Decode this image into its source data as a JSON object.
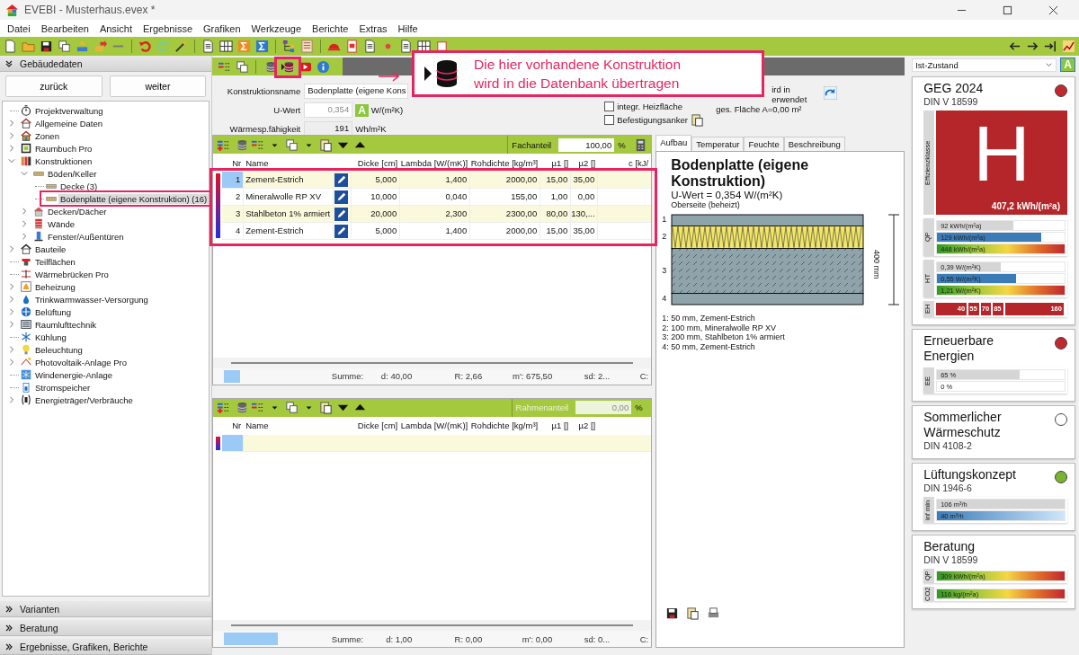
{
  "window": {
    "title": "EVEBI - Musterhaus.evex *"
  },
  "menu": [
    "Datei",
    "Bearbeiten",
    "Ansicht",
    "Ergebnisse",
    "Grafiken",
    "Werkzeuge",
    "Berichte",
    "Extras",
    "Hilfe"
  ],
  "left_panel": {
    "header": "Gebäudedaten",
    "buttons": [
      "zurück",
      "weiter"
    ],
    "tree": [
      {
        "label": "Projektverwaltung",
        "kind": "leaf",
        "selected": false
      },
      {
        "label": "Allgemeine Daten",
        "kind": "folder",
        "expanded": false,
        "selected": false
      },
      {
        "label": "Zonen",
        "kind": "folder",
        "expanded": false,
        "selected": false
      },
      {
        "label": "Raumbuch Pro",
        "kind": "folder",
        "expanded": false,
        "selected": false
      },
      {
        "label": "Konstruktionen",
        "kind": "folder",
        "expanded": true,
        "selected": false,
        "children": [
          {
            "label": "Böden/Keller",
            "kind": "folder",
            "expanded": true,
            "selected": false,
            "children": [
              {
                "label": "Decke (3)",
                "kind": "leaf",
                "selected": false
              },
              {
                "label": "Bodenplatte (eigene Konstruktion) (16)",
                "kind": "leaf",
                "selected": true
              }
            ]
          },
          {
            "label": "Decken/Dächer",
            "kind": "folder",
            "expanded": false,
            "selected": false
          },
          {
            "label": "Wände",
            "kind": "folder",
            "expanded": false,
            "selected": false
          },
          {
            "label": "Fenster/Außentüren",
            "kind": "folder",
            "expanded": false,
            "selected": false
          }
        ]
      },
      {
        "label": "Bauteile",
        "kind": "folder",
        "expanded": false,
        "selected": false
      },
      {
        "label": "Teilflächen",
        "kind": "leaf",
        "selected": false
      },
      {
        "label": "Wärmebrücken Pro",
        "kind": "leaf",
        "selected": false
      },
      {
        "label": "Beheizung",
        "kind": "folder",
        "expanded": false,
        "selected": false
      },
      {
        "label": "Trinkwarmwasser-Versorgung",
        "kind": "folder",
        "expanded": false,
        "selected": false
      },
      {
        "label": "Belüftung",
        "kind": "folder",
        "expanded": false,
        "selected": false
      },
      {
        "label": "Raumlufttechnik",
        "kind": "folder",
        "expanded": false,
        "selected": false
      },
      {
        "label": "Kühlung",
        "kind": "leaf",
        "selected": false
      },
      {
        "label": "Beleuchtung",
        "kind": "folder",
        "expanded": false,
        "selected": false
      },
      {
        "label": "Photovoltaik-Anlage Pro",
        "kind": "folder",
        "expanded": false,
        "selected": false
      },
      {
        "label": "Windenergie-Anlage",
        "kind": "leaf",
        "selected": false
      },
      {
        "label": "Stromspeicher",
        "kind": "leaf",
        "selected": false
      },
      {
        "label": "Energieträger/Verbräuche",
        "kind": "folder",
        "expanded": false,
        "selected": false
      }
    ],
    "sections": [
      "Varianten",
      "Beratung",
      "Ergebnisse, Grafiken, Berichte"
    ]
  },
  "callout": {
    "lines": [
      "Die hier vorhandene Konstruktion",
      "wird in die Datenbank übertragen"
    ]
  },
  "form": {
    "name_label": "Konstruktionsname",
    "name_value": "Bodenplatte (eigene Kons",
    "u_label": "U-Wert",
    "u_value": "0,354",
    "u_class": "A",
    "u_unit": "W/(m²K)",
    "c_label": "Wärmesp.fähigkeit",
    "c_value": "191",
    "c_unit": "Wh/m²K",
    "checkboxes": [
      {
        "label": "integr. Heizfläche",
        "checked": false
      },
      {
        "label": "Befestigungsanker",
        "checked": false
      }
    ],
    "partial_lines": [
      "ird in",
      "erwendet"
    ],
    "area": "ges. Fläche A=0,00 m²"
  },
  "layers_table": {
    "share_label": "Fachanteil",
    "share_value": "100,00",
    "share_unit": "%",
    "share_disabled": false,
    "columns": [
      "Nr",
      "Name",
      "Dicke [cm]",
      "Lambda [W/(mK)]",
      "Rohdichte [kg/m³]",
      "µ1 []",
      "µ2 []",
      "c [kJ/"
    ],
    "rows": [
      {
        "nr": "1",
        "name": "Zement-Estrich",
        "thickness": "5,000",
        "lambda": "1,400",
        "density": "2000,00",
        "mu1": "15,00",
        "mu2": "35,00",
        "selected": true
      },
      {
        "nr": "2",
        "name": "Mineralwolle RP XV",
        "thickness": "10,000",
        "lambda": "0,040",
        "density": "155,00",
        "mu1": "1,00",
        "mu2": "0,00",
        "selected": false
      },
      {
        "nr": "3",
        "name": "Stahlbeton 1% armiert",
        "thickness": "20,000",
        "lambda": "2,300",
        "density": "2300,00",
        "mu1": "80,00",
        "mu2": "130,...",
        "selected": false
      },
      {
        "nr": "4",
        "name": "Zement-Estrich",
        "thickness": "5,000",
        "lambda": "1,400",
        "density": "2000,00",
        "mu1": "15,00",
        "mu2": "35,00",
        "selected": false
      }
    ],
    "summary": [
      "Summe:",
      "d: 40,00",
      "R: 2,66",
      "m': 675,50",
      "sd: 2...",
      "C:"
    ]
  },
  "frame_table": {
    "share_label": "Rahmenanteil",
    "share_value": "0,00",
    "share_unit": "%",
    "share_disabled": true,
    "columns": [
      "Nr",
      "Name",
      "Dicke [cm]",
      "Lambda [W/(mK)]",
      "Rohdichte [kg/m³]",
      "µ1 []",
      "µ2 []"
    ],
    "rows": [
      {
        "selected": true
      }
    ],
    "summary": [
      "Summe:",
      "d: 1,00",
      "R: 0,00",
      "m': 0,00",
      "sd: 0...",
      "C:"
    ]
  },
  "detail_tabs": [
    {
      "label": "Aufbau",
      "selected": true
    },
    {
      "label": "Temperatur",
      "selected": false
    },
    {
      "label": "Feuchte",
      "selected": false
    },
    {
      "label": "Beschreibung",
      "selected": false
    }
  ],
  "detail": {
    "title": "Bodenplatte (eigene Konstruktion)",
    "u_value": "U-Wert = 0,354 W/(m²K)",
    "side": "Oberseite (beheizt)",
    "layers": [
      {
        "label": "1",
        "kind": "screed"
      },
      {
        "label": "2",
        "kind": "insulation"
      },
      {
        "label": "3",
        "kind": "concrete"
      },
      {
        "label": "4",
        "kind": "screed"
      }
    ],
    "dimension": "400 mm",
    "legend": [
      "1:  50 mm, Zement-Estrich",
      "2:  100 mm, Mineralwolle RP XV",
      "3:  200 mm, Stahlbeton 1% armiert",
      "4:  50 mm, Zement-Estrich"
    ]
  },
  "right_panel": {
    "variant": "Ist-Zustand",
    "variant_badge": "A",
    "geg": {
      "title": "GEG 2024",
      "subtitle": "DIN V 18599",
      "color": "#c0282d",
      "class_label": "Effizienzklasse",
      "class": "H",
      "class_value": "407,2 kWh/(m²a)",
      "groups": [
        {
          "label": "QP",
          "bars": [
            {
              "kind": "reference",
              "text": "92 kWh/(m²a)",
              "level": 0.6
            },
            {
              "kind": "value",
              "text": "129 kWh/(m²a)",
              "level": 0.82
            },
            {
              "kind": "scale",
              "text": "448 kWh/(m²a)",
              "level": 1
            }
          ]
        },
        {
          "label": "HT",
          "bars": [
            {
              "kind": "reference",
              "text": "0,39 W/(m²K)",
              "level": 0.5
            },
            {
              "kind": "value",
              "text": "0,55 W/(m²K)",
              "level": 0.62
            },
            {
              "kind": "scale",
              "text": "1,21 W/(m²K)",
              "level": 1
            }
          ]
        }
      ],
      "eh_label": "EH",
      "eh_ticks": [
        "40",
        "55",
        "70",
        "85",
        "160"
      ]
    },
    "cards": [
      {
        "title": "Erneuerbare Energien",
        "color": "#c0282d",
        "groups": [
          {
            "label": "EE",
            "bars": [
              {
                "kind": "reference",
                "text": "65 %",
                "level": 0.65
              },
              {
                "kind": "value",
                "text": "0 %",
                "level": 0
              }
            ]
          }
        ]
      },
      {
        "title": "Sommerlicher Wärmeschutz",
        "subtitle": "DIN 4108-2",
        "color": "#ffffff"
      },
      {
        "title": "Lüftungskonzept",
        "subtitle": "DIN 1946-6",
        "color": "#7ab32e",
        "groups": [
          {
            "label": "inf min",
            "bars": [
              {
                "kind": "reference",
                "text": "106 m³/h",
                "level": 1
              },
              {
                "kind": "light",
                "text": "40 m³/h",
                "level": 1
              }
            ]
          }
        ]
      },
      {
        "title": "Beratung",
        "subtitle": "DIN V 18599",
        "groups": [
          {
            "label": "QP",
            "bars": [
              {
                "kind": "scale",
                "text": "309 kWh/(m²a)",
                "level": 1
              }
            ]
          },
          {
            "label": "CO2",
            "bars": [
              {
                "kind": "scale",
                "text": "116 kg/(m²a)",
                "level": 1
              }
            ]
          }
        ]
      }
    ]
  }
}
